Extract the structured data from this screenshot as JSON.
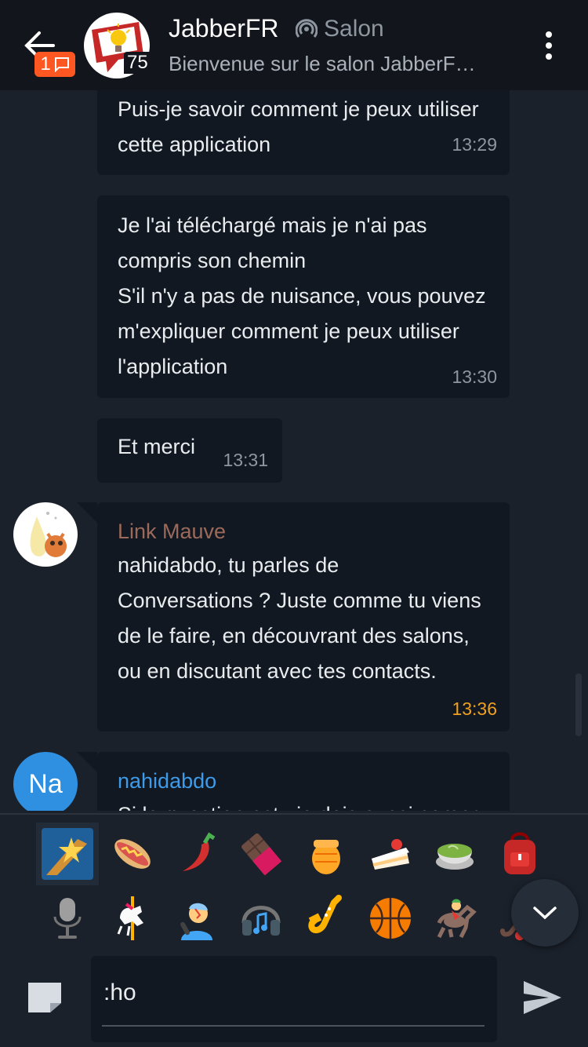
{
  "header": {
    "unread_count": "1",
    "room_name": "JabberFR",
    "room_type": "Salon",
    "participants": "75",
    "subject": "Bienvenue sur le salon JabberF…"
  },
  "messages": [
    {
      "lines": [
        "Puis-je savoir comment je peux utiliser",
        "cette application"
      ],
      "time": "13:29"
    },
    {
      "lines": [
        "Je l'ai téléchargé mais je n'ai pas",
        "compris son chemin",
        "S'il n'y a pas de nuisance, vous pouvez",
        "m'expliquer comment je peux utiliser",
        "l'application"
      ],
      "time": "13:30"
    },
    {
      "lines": [
        "Et merci"
      ],
      "time": "13:31"
    },
    {
      "sender": "Link Mauve",
      "lines": [
        "nahidabdo, tu parles de",
        "Conversations ? Juste comme tu viens",
        "de le faire, en découvrant des salons,",
        "ou en discutant avec tes contacts."
      ],
      "time": "13:36"
    },
    {
      "sender": "nahidabdo",
      "avatar_initials": "Na",
      "lines": [
        "Si la question est : je dois aussi compr"
      ]
    }
  ],
  "colors": {
    "accent": "#ff5722",
    "link_mauve": "#9c6a5a",
    "nahidabdo": "#3d9be9",
    "highlight_time": "#f0a020"
  },
  "emoji_row1": [
    "shooting-star",
    "hot-dog",
    "hot-pepper",
    "chocolate-bar",
    "honey-pot",
    "shortcake",
    "teacup",
    "backpack"
  ],
  "emoji_row2": [
    "studio-microphone",
    "carousel-horse",
    "singer",
    "headphone",
    "saxophone",
    "basketball",
    "horse-racing",
    "field-hockey"
  ],
  "input": {
    "value": ":ho"
  }
}
